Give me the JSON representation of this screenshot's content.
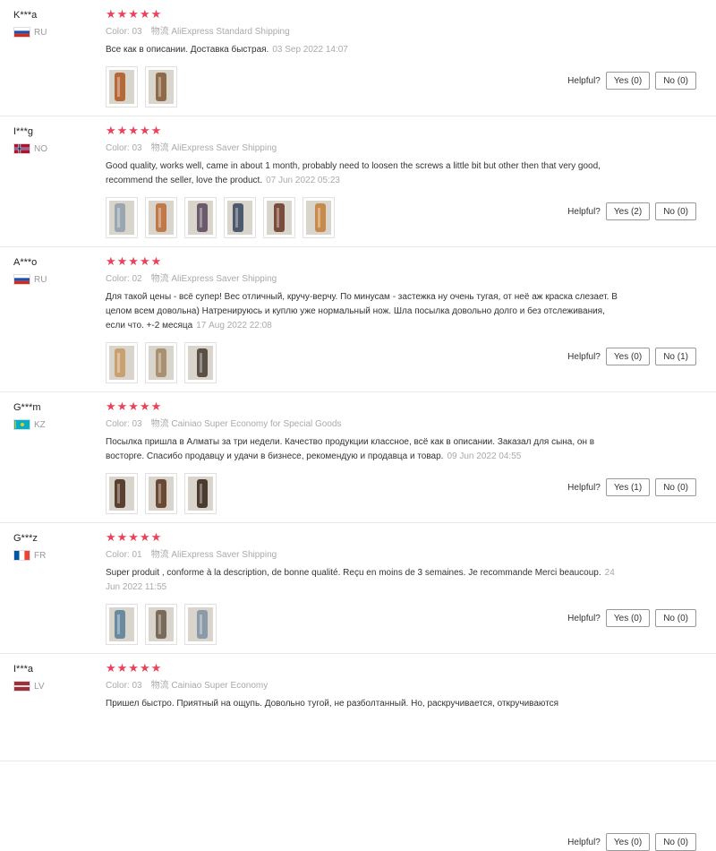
{
  "reviews": [
    {
      "user": "K***a",
      "country": "RU",
      "flag": "ru",
      "stars": "★★★★★",
      "color_label": "Color:",
      "color": "03",
      "shipping_label": "物流",
      "shipping": "AliExpress Standard Shipping",
      "text": "Все как в описании. Доставка быстрая.",
      "date": "03 Sep 2022 14:07",
      "photos": 2,
      "photo_colors": [
        "#b5683a",
        "#8e6a4a"
      ],
      "helpful_label": "Helpful?",
      "yes": "Yes (0)",
      "no": "No (0)"
    },
    {
      "user": "I***g",
      "country": "NO",
      "flag": "no",
      "stars": "★★★★★",
      "color_label": "Color:",
      "color": "03",
      "shipping_label": "物流",
      "shipping": "AliExpress Saver Shipping",
      "text": "Good quality, works well, came in about 1 month, probably need to loosen the screws a little bit but other then that very good, recommend the seller, love the product.",
      "date": "07 Jun 2022 05:23",
      "photos": 6,
      "photo_colors": [
        "#9aa6b0",
        "#c07a4a",
        "#6a5a6a",
        "#4c5a6c",
        "#7a4c3c",
        "#c88a4a"
      ],
      "helpful_label": "Helpful?",
      "yes": "Yes (2)",
      "no": "No (0)"
    },
    {
      "user": "A***o",
      "country": "RU",
      "flag": "ru",
      "stars": "★★★★★",
      "color_label": "Color:",
      "color": "02",
      "shipping_label": "物流",
      "shipping": "AliExpress Saver Shipping",
      "text": "Для такой цены - всё супер! Вес отличный, кручу-верчу. По минусам - застежка ну очень тугая, от неё аж краска слезает. В целом всем довольна) Натренируюсь и куплю уже нормальный нож. Шла посылка довольно долго и без отслеживания, если что. +-2 месяца",
      "date": "17 Aug 2022 22:08",
      "photos": 3,
      "photo_colors": [
        "#c9a070",
        "#a89070",
        "#5a5048"
      ],
      "helpful_label": "Helpful?",
      "yes": "Yes (0)",
      "no": "No (1)"
    },
    {
      "user": "G***m",
      "country": "KZ",
      "flag": "kz",
      "stars": "★★★★★",
      "color_label": "Color:",
      "color": "03",
      "shipping_label": "物流",
      "shipping": "Cainiao Super Economy for Special Goods",
      "text": "Посылка пришла в Алматы за три недели. Качество продукции классное, всё как в описании. Заказал для сына, он в восторге. Спасибо продавцу и удачи в бизнесе, рекомендую и продавца и товар.",
      "date": "09 Jun 2022 04:55",
      "photos": 3,
      "photo_colors": [
        "#5a4030",
        "#6a4a34",
        "#4a3a30"
      ],
      "helpful_label": "Helpful?",
      "yes": "Yes (1)",
      "no": "No (0)"
    },
    {
      "user": "G***z",
      "country": "FR",
      "flag": "fr",
      "stars": "★★★★★",
      "color_label": "Color:",
      "color": "01",
      "shipping_label": "物流",
      "shipping": "AliExpress Saver Shipping",
      "text": "Super produit , conforme à la description, de bonne qualité. Reçu en moins de 3 semaines. Je recommande Merci beaucoup.",
      "date": "24 Jun 2022 11:55",
      "photos": 3,
      "photo_colors": [
        "#6a8aa0",
        "#7a6a5a",
        "#8a9aa8"
      ],
      "helpful_label": "Helpful?",
      "yes": "Yes (0)",
      "no": "No (0)"
    },
    {
      "user": "I***a",
      "country": "LV",
      "flag": "lv",
      "stars": "★★★★★",
      "color_label": "Color:",
      "color": "03",
      "shipping_label": "物流",
      "shipping": "Cainiao Super Economy",
      "text": "Пришел быстро. Приятный на ощупь. Довольно тугой, не разболтанный. Но, раскручивается, откручиваются",
      "date": "",
      "photos": 0,
      "photo_colors": [],
      "helpful_label": "Helpful?",
      "yes": "Yes (0)",
      "no": "No (0)"
    }
  ]
}
